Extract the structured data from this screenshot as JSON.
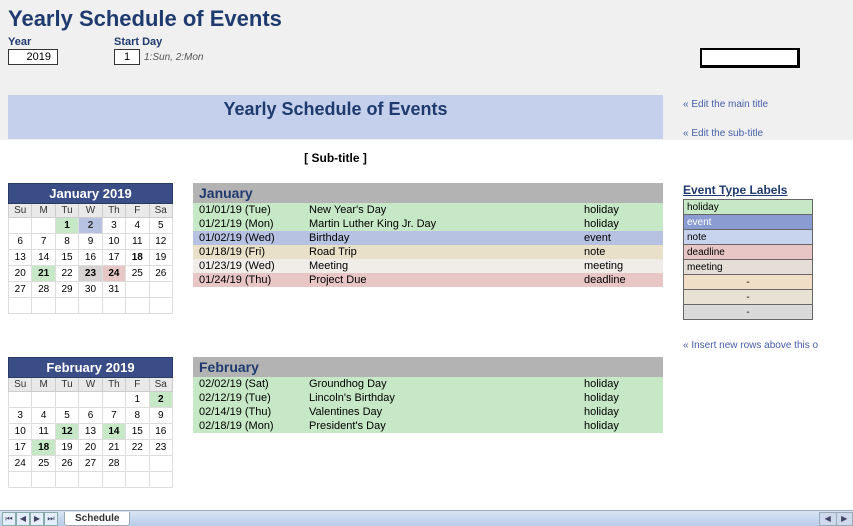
{
  "header": {
    "page_title": "Yearly Schedule of Events",
    "year_label": "Year",
    "year_value": "2019",
    "startday_label": "Start Day",
    "startday_value": "1",
    "startday_hint": "1:Sun, 2:Mon"
  },
  "banner": {
    "title": "Yearly Schedule of Events",
    "subtitle": "[ Sub-title ]"
  },
  "hints": {
    "edit_main": "« Edit the main title",
    "edit_sub": "« Edit the sub-title",
    "insert_rows": "« Insert new rows above this o"
  },
  "months": [
    {
      "cal_title": "January 2019",
      "ev_title": "January",
      "days": [
        "Su",
        "M",
        "Tu",
        "W",
        "Th",
        "F",
        "Sa"
      ],
      "grid": [
        [
          "",
          "",
          "1",
          "2",
          "3",
          "4",
          "5"
        ],
        [
          "6",
          "7",
          "8",
          "9",
          "10",
          "11",
          "12"
        ],
        [
          "13",
          "14",
          "15",
          "16",
          "17",
          "18",
          "19"
        ],
        [
          "20",
          "21",
          "22",
          "23",
          "24",
          "25",
          "26"
        ],
        [
          "27",
          "28",
          "29",
          "30",
          "31",
          "",
          ""
        ],
        [
          "",
          "",
          "",
          "",
          "",
          "",
          ""
        ]
      ],
      "cell_types": {
        "1": "hol",
        "2": "ev",
        "18": "nt",
        "21": "hol",
        "23": "mt",
        "24": "dl"
      },
      "events": [
        {
          "date": "01/01/19 (Tue)",
          "name": "New Year's Day",
          "type": "holiday",
          "cls": "ev-holiday"
        },
        {
          "date": "01/21/19 (Mon)",
          "name": "Martin Luther King Jr. Day",
          "type": "holiday",
          "cls": "ev-holiday"
        },
        {
          "date": "01/02/19 (Wed)",
          "name": "Birthday",
          "type": "event",
          "cls": "ev-event"
        },
        {
          "date": "01/18/19 (Fri)",
          "name": "Road Trip",
          "type": "note",
          "cls": "ev-note"
        },
        {
          "date": "01/23/19 (Wed)",
          "name": "Meeting",
          "type": "meeting",
          "cls": "ev-meeting"
        },
        {
          "date": "01/24/19 (Thu)",
          "name": "Project Due",
          "type": "deadline",
          "cls": "ev-deadline"
        }
      ]
    },
    {
      "cal_title": "February 2019",
      "ev_title": "February",
      "days": [
        "Su",
        "M",
        "Tu",
        "W",
        "Th",
        "F",
        "Sa"
      ],
      "grid": [
        [
          "",
          "",
          "",
          "",
          "",
          "1",
          "2"
        ],
        [
          "3",
          "4",
          "5",
          "6",
          "7",
          "8",
          "9"
        ],
        [
          "10",
          "11",
          "12",
          "13",
          "14",
          "15",
          "16"
        ],
        [
          "17",
          "18",
          "19",
          "20",
          "21",
          "22",
          "23"
        ],
        [
          "24",
          "25",
          "26",
          "27",
          "28",
          "",
          ""
        ],
        [
          "",
          "",
          "",
          "",
          "",
          "",
          ""
        ]
      ],
      "cell_types": {
        "2": "hol",
        "12": "hol",
        "14": "hol",
        "18": "hol"
      },
      "events": [
        {
          "date": "02/02/19 (Sat)",
          "name": "Groundhog Day",
          "type": "holiday",
          "cls": "ev-holiday"
        },
        {
          "date": "02/12/19 (Tue)",
          "name": "Lincoln's Birthday",
          "type": "holiday",
          "cls": "ev-holiday"
        },
        {
          "date": "02/14/19 (Thu)",
          "name": "Valentines Day",
          "type": "holiday",
          "cls": "ev-holiday"
        },
        {
          "date": "02/18/19 (Mon)",
          "name": "President's Day",
          "type": "holiday",
          "cls": "ev-holiday"
        }
      ]
    }
  ],
  "labels_panel": {
    "title": "Event Type Labels",
    "rows": [
      {
        "text": "holiday",
        "cls": "lt-holiday"
      },
      {
        "text": "event",
        "cls": "lt-event"
      },
      {
        "text": "note",
        "cls": "lt-note"
      },
      {
        "text": "deadline",
        "cls": "lt-deadline"
      },
      {
        "text": "meeting",
        "cls": "lt-meeting"
      },
      {
        "text": "-",
        "cls": "lt-placeholder1"
      },
      {
        "text": "-",
        "cls": "lt-placeholder2"
      },
      {
        "text": "-",
        "cls": "lt-placeholder3"
      }
    ]
  },
  "tab": {
    "name": "Schedule"
  }
}
